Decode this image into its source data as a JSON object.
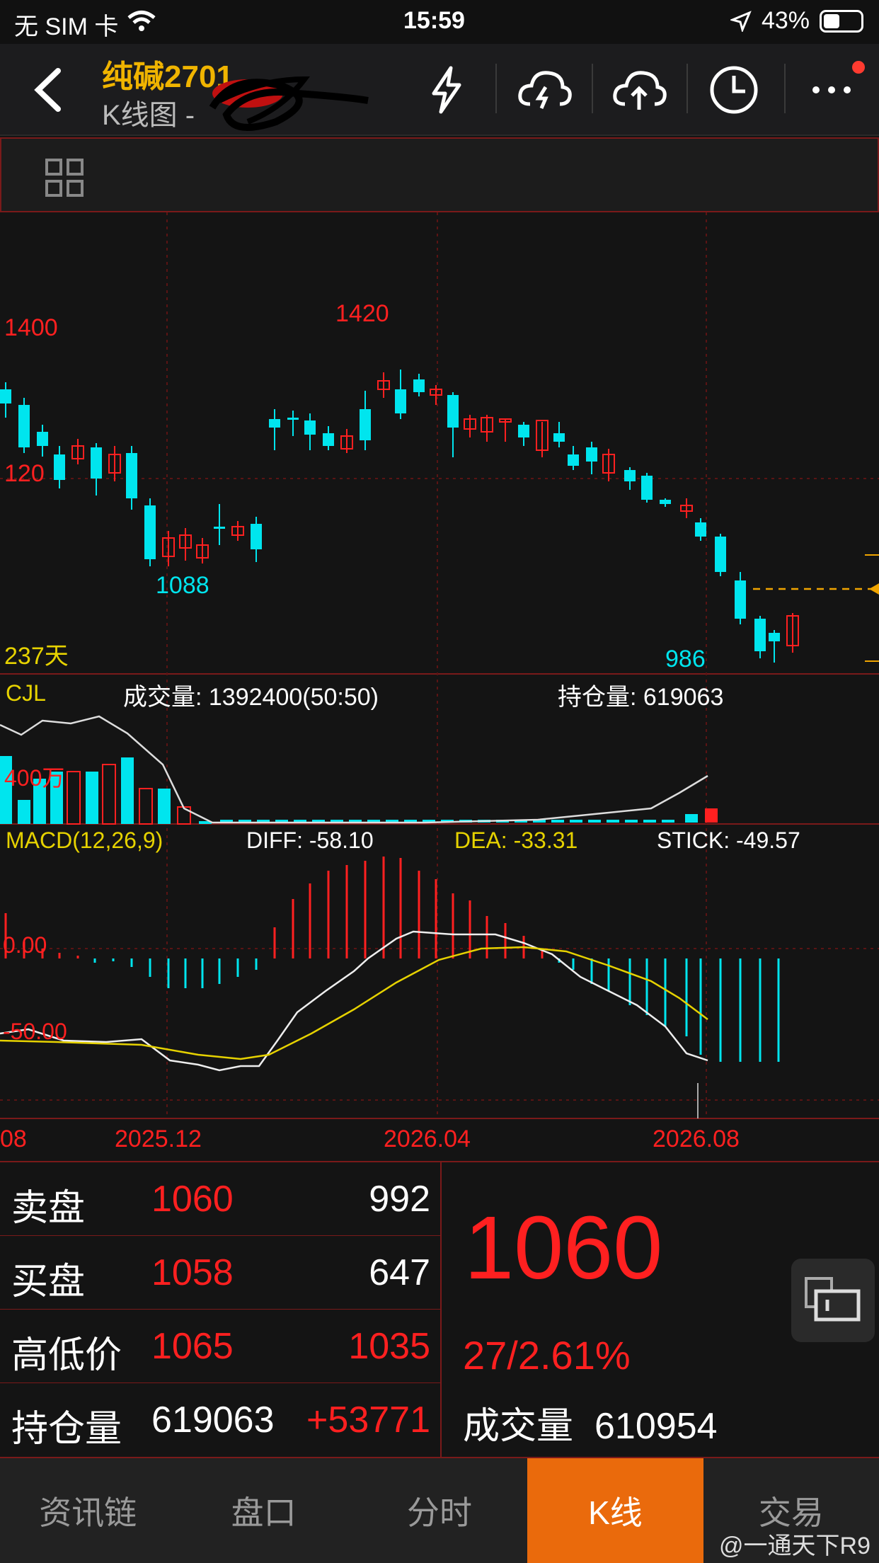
{
  "status": {
    "carrier": "无 SIM 卡",
    "time": "15:59",
    "battery": "43%"
  },
  "header": {
    "title": "纯碱2701",
    "subtitle": "K线图 -",
    "icons": [
      "lightning-icon",
      "cloud-lightning-icon",
      "cloud-upload-icon",
      "clock-icon",
      "more-icon"
    ]
  },
  "chart": {
    "price_labels": {
      "high": "1420",
      "low_mid": "1088",
      "low": "986",
      "y1400": "1400",
      "y120": "120",
      "days": "237天"
    },
    "volume": {
      "title": "CJL",
      "vol_label": "成交量: 1392400(50:50)",
      "oi_label": "持仓量: 619063",
      "axis_label": "400万"
    },
    "macd": {
      "title": "MACD(12,26,9)",
      "diff": "DIFF: -58.10",
      "dea": "DEA: -33.31",
      "stick": "STICK: -49.57",
      "zero": "0.00",
      "neg50": "-50.00"
    },
    "dates": [
      "08",
      "2025.12",
      "2026.04",
      "2026.08"
    ]
  },
  "quote": {
    "rows": [
      {
        "label": "卖盘",
        "v1": "1060",
        "v2": "992"
      },
      {
        "label": "买盘",
        "v1": "1058",
        "v2": "647"
      },
      {
        "label": "高低价",
        "v1": "1065",
        "v2": "1035"
      },
      {
        "label": "持仓量",
        "v1": "619063",
        "v2": "+53771"
      }
    ],
    "last_price": "1060",
    "change": "27/2.61%",
    "volume_label": "成交量",
    "volume_value": "610954"
  },
  "tabs": [
    "资讯链",
    "盘口",
    "分时",
    "K线",
    "交易"
  ],
  "active_tab": "K线",
  "watermark": "@一通天下R9",
  "colors": {
    "up": "#ff2020",
    "down": "#00e5ee",
    "accent": "#ea6a0c",
    "title": "#f0b400"
  }
}
